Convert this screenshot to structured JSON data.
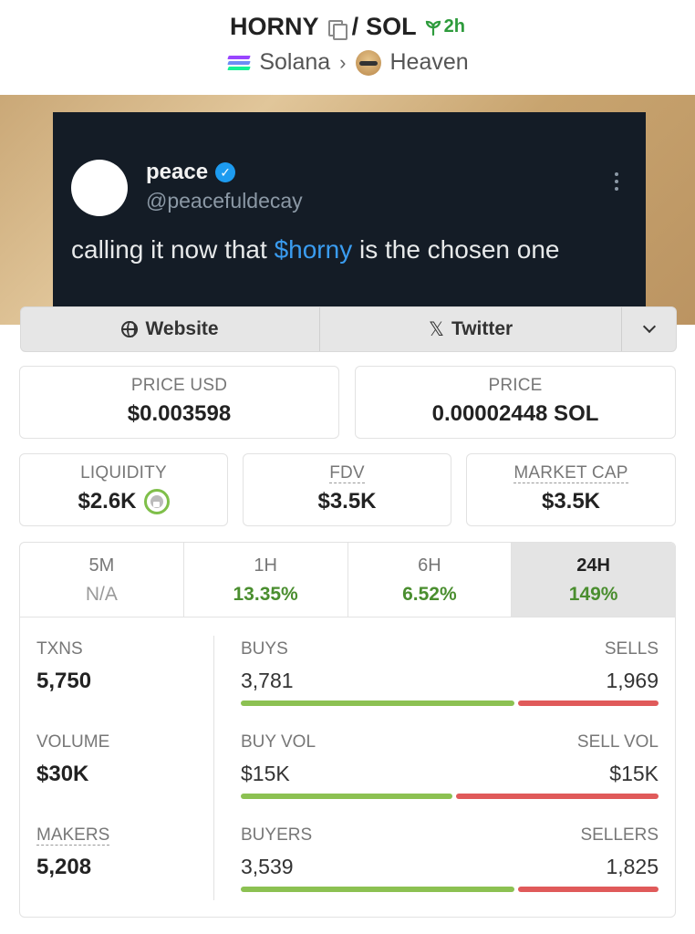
{
  "header": {
    "token": "HORNY",
    "separator": "/",
    "quote": "SOL",
    "age": "2h",
    "chain": "Solana",
    "dex": "Heaven"
  },
  "tweet": {
    "name": "peace",
    "handle": "@peacefuldecay",
    "text_before": "calling it now that ",
    "cashtag": "$horny",
    "text_after": " is the chosen one"
  },
  "links": {
    "website": "Website",
    "twitter": "Twitter"
  },
  "prices": {
    "price_usd_label": "PRICE USD",
    "price_usd": "$0.003598",
    "price_label": "PRICE",
    "price_sol": "0.00002448 SOL"
  },
  "metrics": {
    "liquidity_label": "LIQUIDITY",
    "liquidity": "$2.6K",
    "fdv_label": "FDV",
    "fdv": "$3.5K",
    "mcap_label": "MARKET CAP",
    "mcap": "$3.5K"
  },
  "periods": [
    {
      "label": "5M",
      "value": "N/A"
    },
    {
      "label": "1H",
      "value": "13.35%"
    },
    {
      "label": "6H",
      "value": "6.52%"
    },
    {
      "label": "24H",
      "value": "149%"
    }
  ],
  "active_period": "24H",
  "stats": {
    "txns_label": "TXNS",
    "txns": "5,750",
    "buys_label": "BUYS",
    "buys": "3,781",
    "sells_label": "SELLS",
    "sells": "1,969",
    "volume_label": "VOLUME",
    "volume": "$30K",
    "buy_vol_label": "BUY VOL",
    "buy_vol": "$15K",
    "sell_vol_label": "SELL VOL",
    "sell_vol": "$15K",
    "makers_label": "MAKERS",
    "makers": "5,208",
    "buyers_label": "BUYERS",
    "buyers": "3,539",
    "sellers_label": "SELLERS",
    "sellers": "1,825"
  },
  "bars": {
    "buys_fraction": 0.66,
    "buy_vol_fraction": 0.51,
    "buyers_fraction": 0.66
  },
  "colors": {
    "green": "#8cc152",
    "red": "#e05a5a",
    "positive_text": "#4a8e2f",
    "twitter_blue": "#1d9bf0"
  }
}
